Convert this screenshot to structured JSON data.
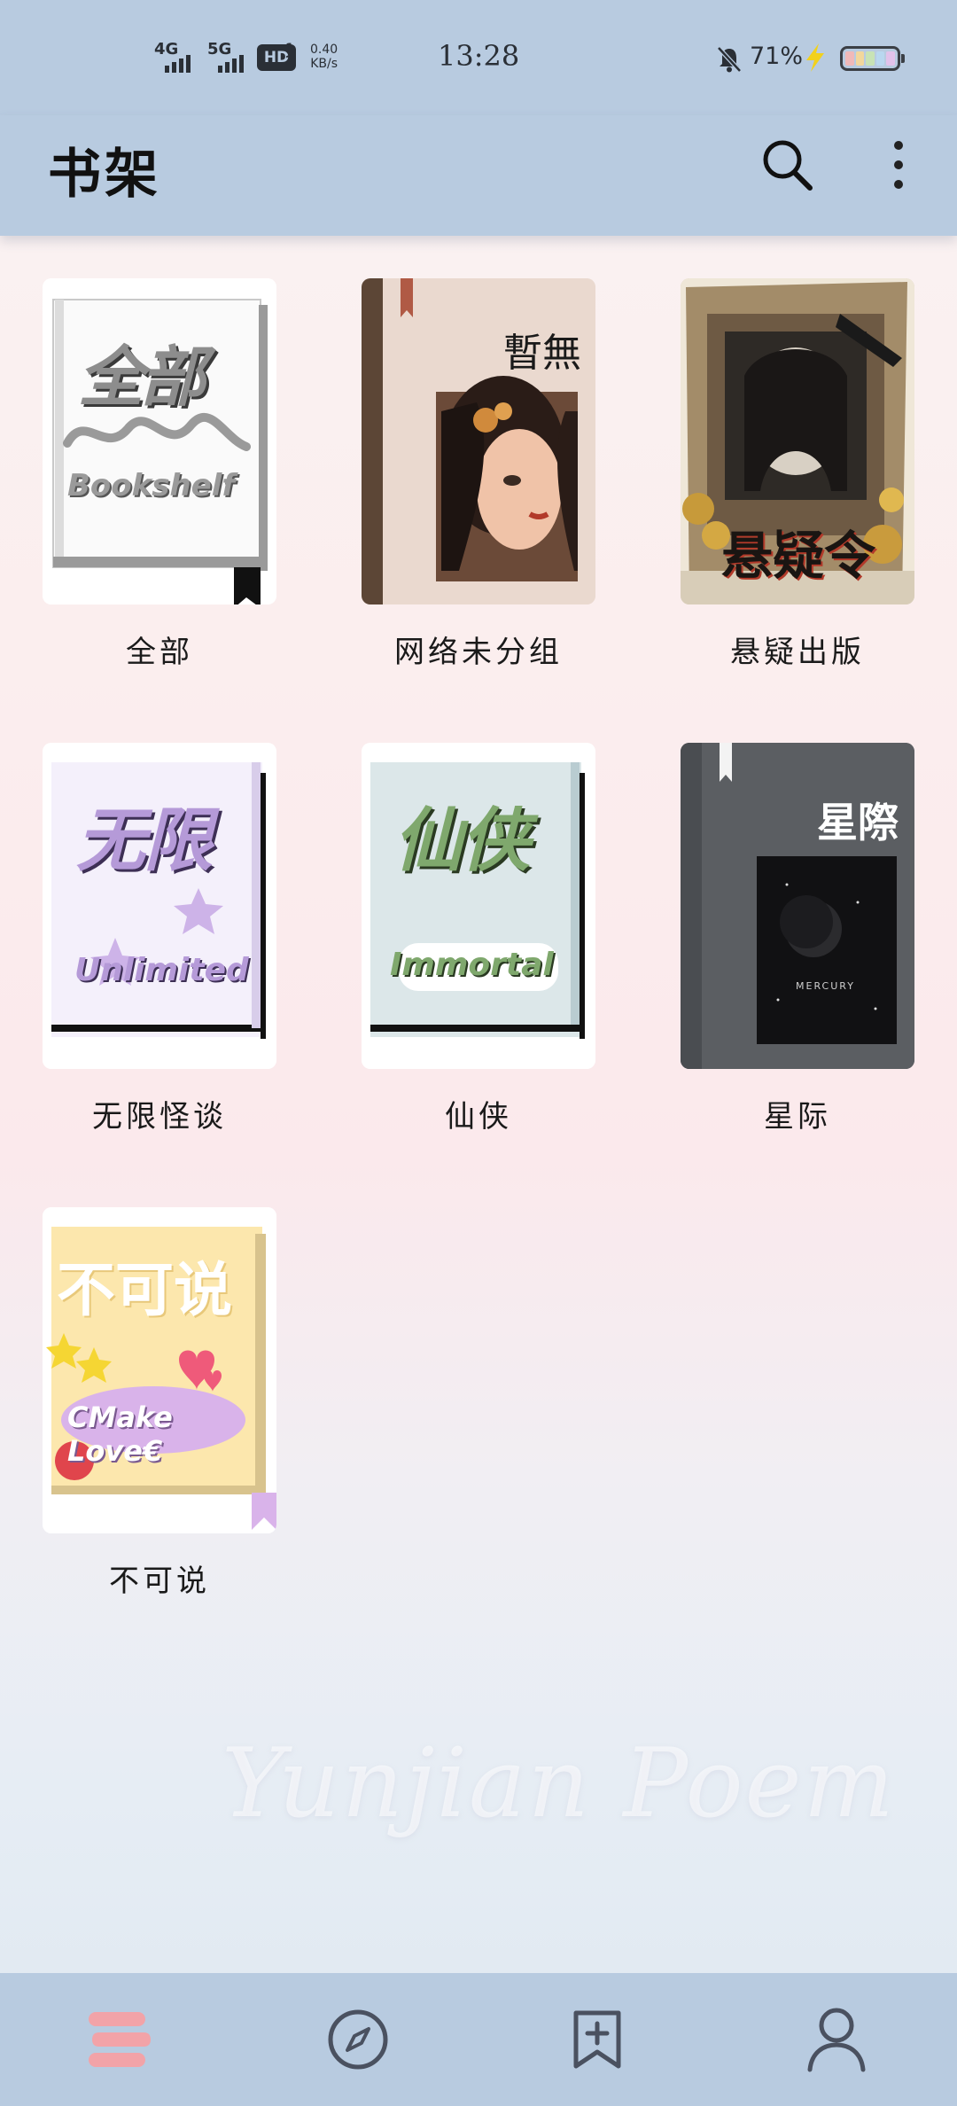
{
  "status_bar": {
    "network_1": "4G",
    "network_2": "5G",
    "hd": "HD",
    "hd_slots": "1\n2",
    "speed_value": "0.40",
    "speed_unit": "KB/s",
    "time": "13:28",
    "battery_percent": "71%"
  },
  "header": {
    "title": "书架",
    "search_icon": "search-icon",
    "more_icon": "more-vertical-icon"
  },
  "books": [
    {
      "label": "全部",
      "cover_title": "全部",
      "cover_subtitle": "Bookshelf"
    },
    {
      "label": "网络未分组",
      "cover_title": "暫無"
    },
    {
      "label": "悬疑出版",
      "cover_title": "悬疑令"
    },
    {
      "label": "无限怪谈",
      "cover_title": "无限",
      "cover_subtitle": "Unlimited"
    },
    {
      "label": "仙侠",
      "cover_title": "仙侠",
      "cover_subtitle": "Immortal"
    },
    {
      "label": "星际",
      "cover_title": "星際",
      "cover_caption": "MERCURY"
    },
    {
      "label": "不可说",
      "cover_title": "不可说",
      "cover_subtitle": "CMake Love€"
    }
  ],
  "watermark": "Yunjian Poem",
  "bottom_nav": [
    {
      "icon": "bookshelf-icon",
      "active": true
    },
    {
      "icon": "compass-icon",
      "active": false
    },
    {
      "icon": "bookmark-add-icon",
      "active": false
    },
    {
      "icon": "person-icon",
      "active": false
    }
  ],
  "colors": {
    "bar": "#b8cbe0",
    "active_nav": "#f2a3a8",
    "nav_icon": "#4a5160"
  }
}
